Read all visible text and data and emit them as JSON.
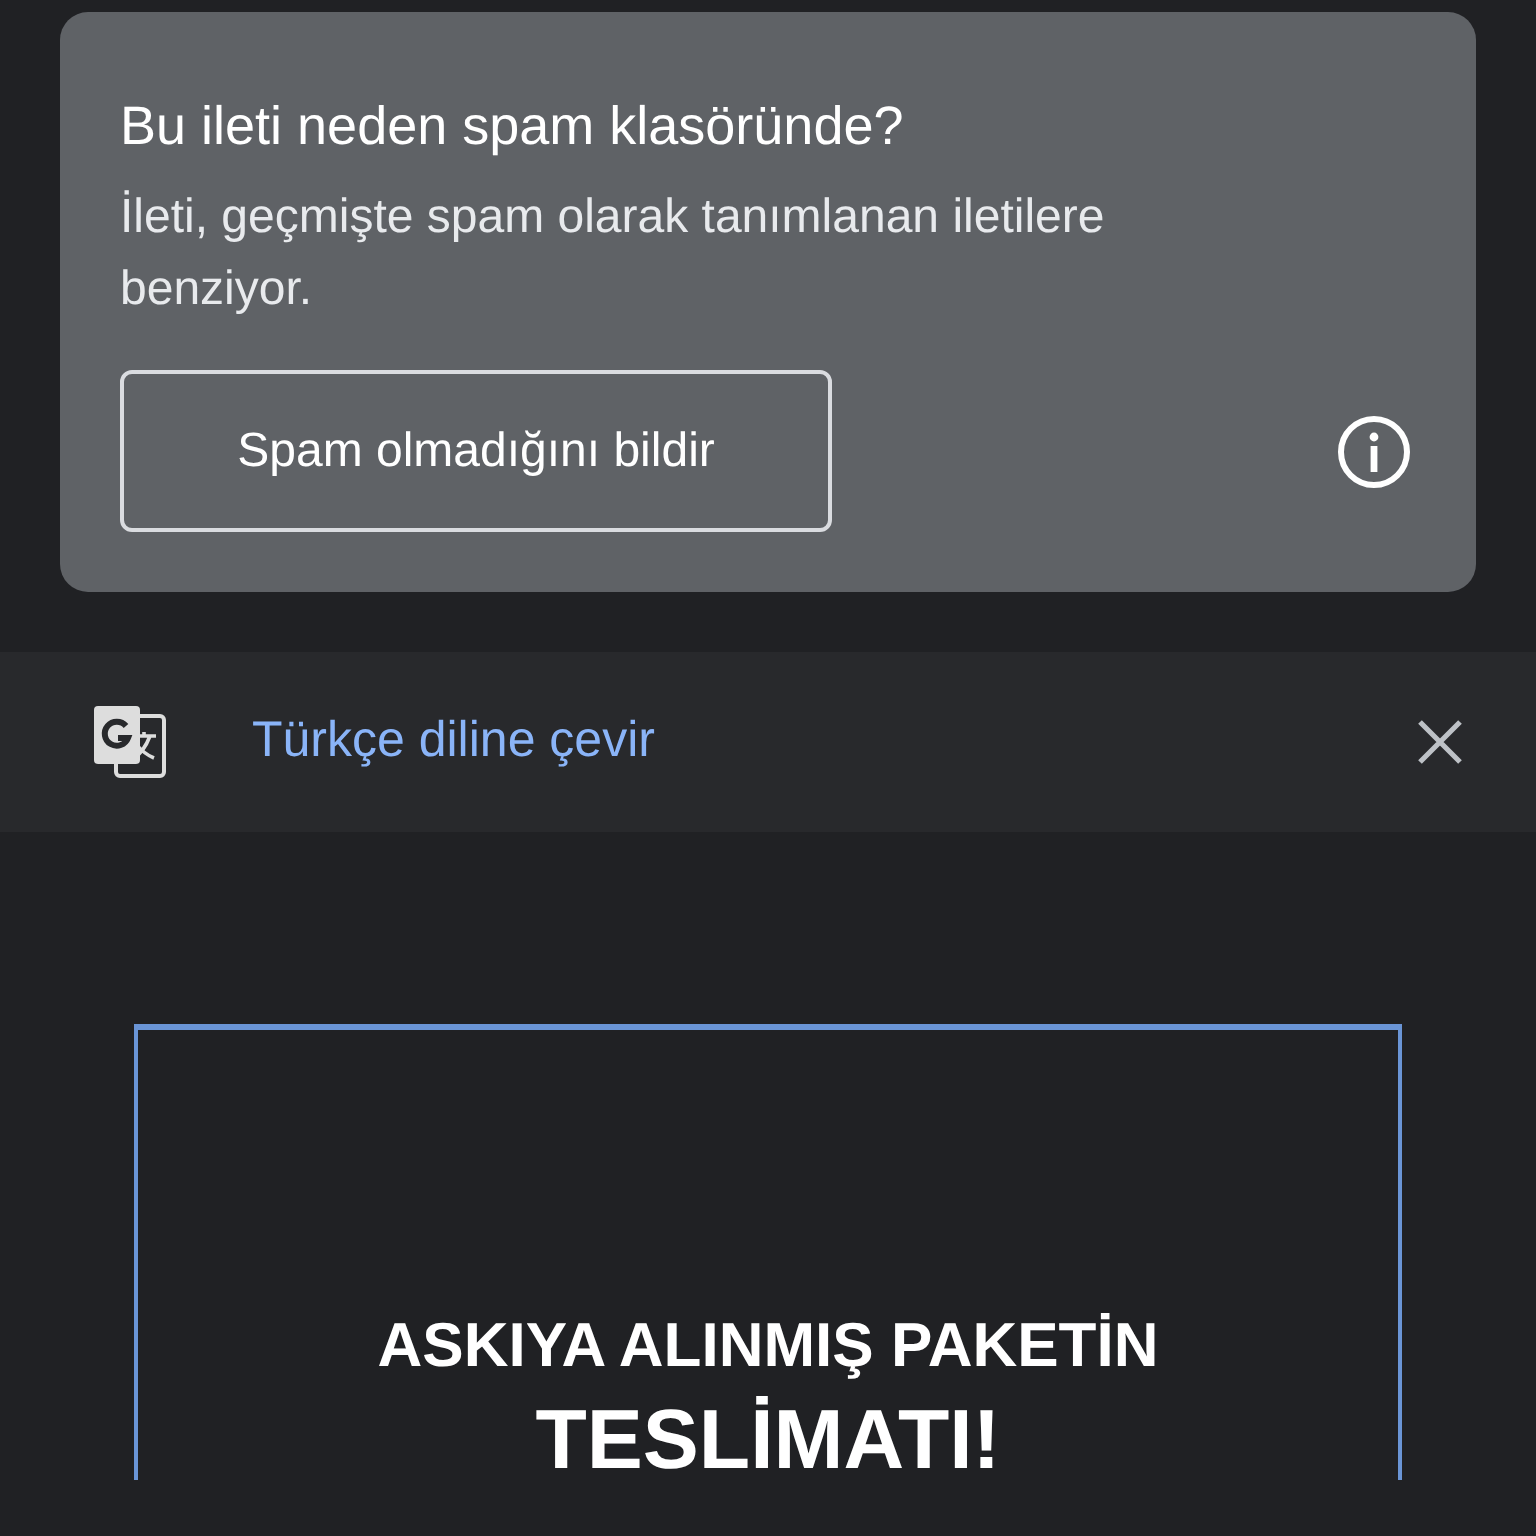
{
  "spam_notice": {
    "title": "Bu ileti neden spam klasöründe?",
    "message": "İleti, geçmişte spam olarak tanımlanan iletilere benziyor.",
    "button": "Spam olmadığını bildir"
  },
  "translate_bar": {
    "link": "Türkçe diline çevir"
  },
  "email_body": {
    "lines": [
      "ASKIYA ALINMIŞ PAKETİN",
      "TESLİMATI!"
    ]
  }
}
